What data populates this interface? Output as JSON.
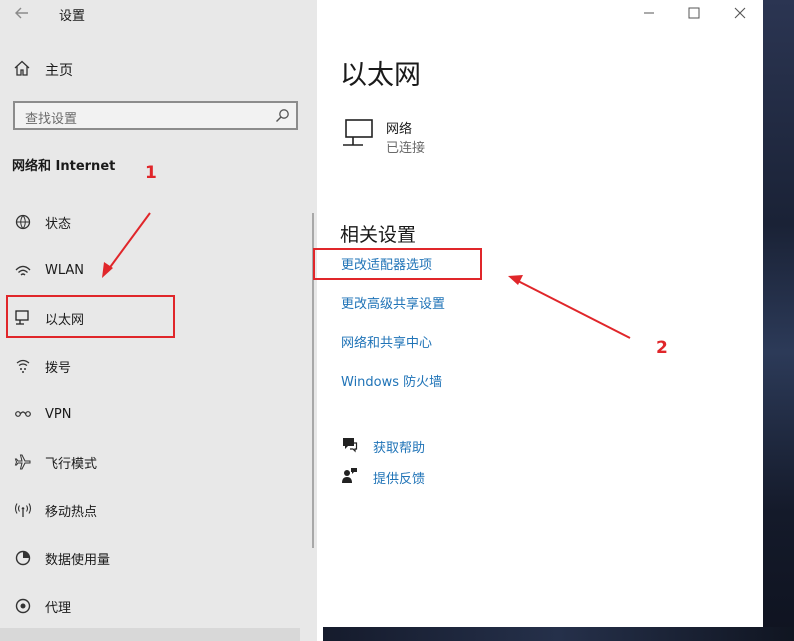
{
  "window": {
    "title": "设置",
    "back_icon": "back-arrow-icon",
    "controls": {
      "minimize": "—",
      "maximize": "☐",
      "close": "✕"
    }
  },
  "sidebar": {
    "home_label": "主页",
    "search_placeholder": "查找设置",
    "section_title": "网络和 Internet",
    "items": [
      {
        "label": "状态",
        "icon": "status-icon"
      },
      {
        "label": "WLAN",
        "icon": "wifi-icon"
      },
      {
        "label": "以太网",
        "icon": "ethernet-icon"
      },
      {
        "label": "拨号",
        "icon": "dialup-icon"
      },
      {
        "label": "VPN",
        "icon": "vpn-icon"
      },
      {
        "label": "飞行模式",
        "icon": "airplane-icon"
      },
      {
        "label": "移动热点",
        "icon": "hotspot-icon"
      },
      {
        "label": "数据使用量",
        "icon": "data-usage-icon"
      },
      {
        "label": "代理",
        "icon": "proxy-icon"
      }
    ]
  },
  "main": {
    "page_title": "以太网",
    "network": {
      "name": "网络",
      "status": "已连接"
    },
    "related_title": "相关设置",
    "links": [
      "更改适配器选项",
      "更改高级共享设置",
      "网络和共享中心",
      "Windows 防火墙"
    ],
    "help": {
      "get_help": "获取帮助",
      "feedback": "提供反馈"
    }
  },
  "annotations": {
    "label_1": "1",
    "label_2": "2",
    "color": "#e0262a"
  },
  "colors": {
    "sidebar_bg": "#e8e8e8",
    "link": "#1f73b7",
    "text": "#1a1a1a"
  }
}
